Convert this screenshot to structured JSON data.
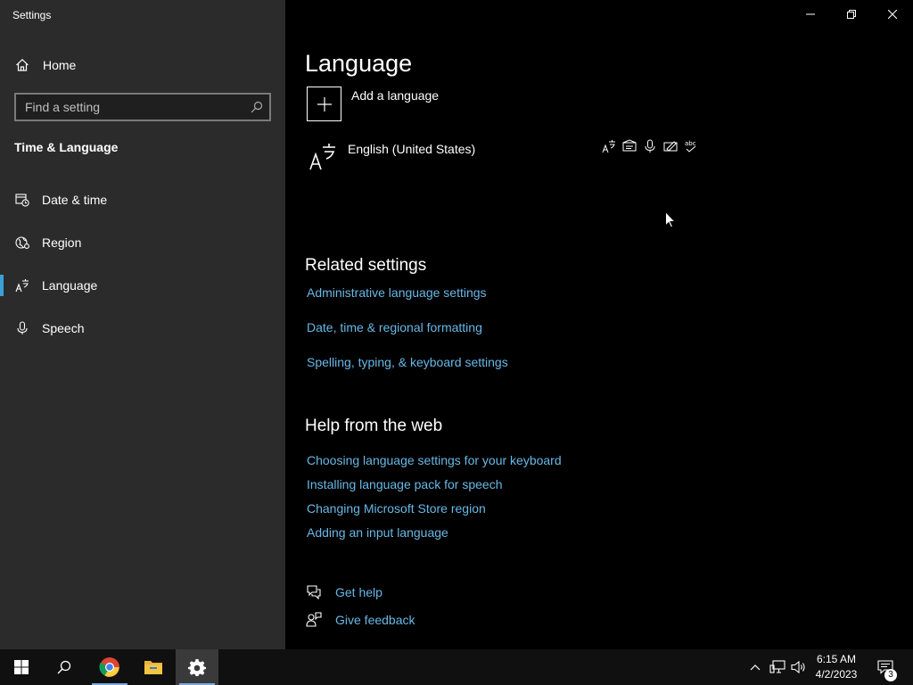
{
  "window": {
    "title": "Settings"
  },
  "sidebar": {
    "home_label": "Home",
    "search_placeholder": "Find a setting",
    "section_title": "Time & Language",
    "items": [
      {
        "label": "Date & time",
        "icon": "calendar-clock-icon"
      },
      {
        "label": "Region",
        "icon": "globe-icon"
      },
      {
        "label": "Language",
        "icon": "language-icon",
        "active": true
      },
      {
        "label": "Speech",
        "icon": "microphone-icon"
      }
    ]
  },
  "main": {
    "title": "Language",
    "add_language": "Add a language",
    "installed_language": "English (United States)",
    "related_settings": {
      "heading": "Related settings",
      "links": [
        "Administrative language settings",
        "Date, time & regional formatting",
        "Spelling, typing, & keyboard settings"
      ]
    },
    "help_from_web": {
      "heading": "Help from the web",
      "links": [
        "Choosing language settings for your keyboard",
        "Installing language pack for speech",
        "Changing Microsoft Store region",
        "Adding an input language"
      ]
    },
    "get_help": "Get help",
    "give_feedback": "Give feedback"
  },
  "taskbar": {
    "time": "6:15 AM",
    "date": "4/2/2023",
    "notification_count": "3"
  },
  "colors": {
    "accent": "#3aa0d8",
    "link": "#68b8e6",
    "sidebar_bg": "#2b2b2b",
    "content_bg": "#000000"
  }
}
